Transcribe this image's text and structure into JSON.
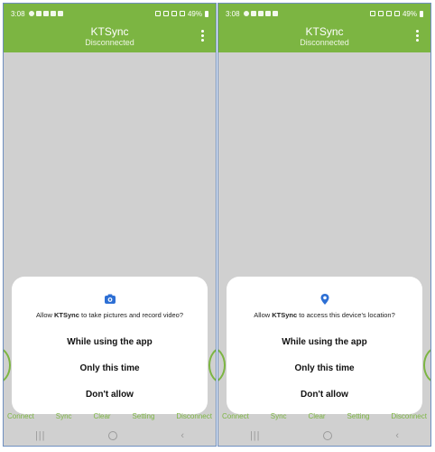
{
  "screens": [
    {
      "status": {
        "time": "3:08",
        "battery": "49%"
      },
      "app": {
        "title": "KTSync",
        "subtitle": "Disconnected"
      },
      "dialog": {
        "icon": "camera-icon",
        "message_prefix": "Allow ",
        "message_app": "KTSync",
        "message_suffix": " to take pictures and record video?",
        "options": [
          "While using the app",
          "Only this time",
          "Don't allow"
        ]
      },
      "tabs": [
        "Connect",
        "Sync",
        "Clear",
        "Setting",
        "Disconnect"
      ]
    },
    {
      "status": {
        "time": "3:08",
        "battery": "49%"
      },
      "app": {
        "title": "KTSync",
        "subtitle": "Disconnected"
      },
      "dialog": {
        "icon": "location-pin-icon",
        "message_prefix": "Allow ",
        "message_app": "KTSync",
        "message_suffix": " to access this device's location?",
        "options": [
          "While using the app",
          "Only this time",
          "Don't allow"
        ]
      },
      "tabs": [
        "Connect",
        "Sync",
        "Clear",
        "Setting",
        "Disconnect"
      ]
    }
  ],
  "colors": {
    "brand": "#7cb542",
    "dialog_icon": "#2d6fd4",
    "background": "#d0d0d0"
  }
}
